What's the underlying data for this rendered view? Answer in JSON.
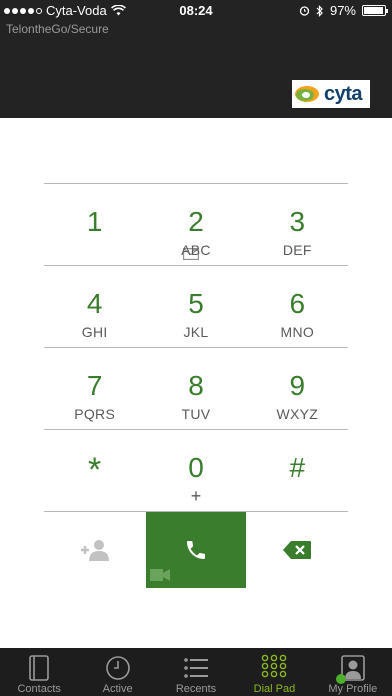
{
  "status_bar": {
    "carrier": "Cyta-Voda",
    "time": "08:24",
    "battery": "97%",
    "battery_level": 0.97
  },
  "header": {
    "subtitle": "TelontheGo/Secure",
    "logo_text": "cyta"
  },
  "dial_pad": {
    "keys": [
      {
        "digit": "1",
        "sub": ""
      },
      {
        "digit": "2",
        "sub": "ABC"
      },
      {
        "digit": "3",
        "sub": "DEF"
      },
      {
        "digit": "4",
        "sub": "GHI"
      },
      {
        "digit": "5",
        "sub": "JKL"
      },
      {
        "digit": "6",
        "sub": "MNO"
      },
      {
        "digit": "7",
        "sub": "PQRS"
      },
      {
        "digit": "8",
        "sub": "TUV"
      },
      {
        "digit": "9",
        "sub": "WXYZ"
      },
      {
        "digit": "*",
        "sub": ""
      },
      {
        "digit": "0",
        "sub": "+"
      },
      {
        "digit": "#",
        "sub": ""
      }
    ]
  },
  "tabs": [
    {
      "label": "Contacts",
      "icon": "contacts-icon"
    },
    {
      "label": "Active",
      "icon": "clock-icon"
    },
    {
      "label": "Recents",
      "icon": "list-icon"
    },
    {
      "label": "Dial Pad",
      "icon": "dialpad-icon",
      "active": true
    },
    {
      "label": "My Profile",
      "icon": "profile-icon"
    }
  ],
  "colors": {
    "accent_green": "#3a7d2c",
    "active_tab": "#8ab81e",
    "header_bg": "#232323"
  }
}
